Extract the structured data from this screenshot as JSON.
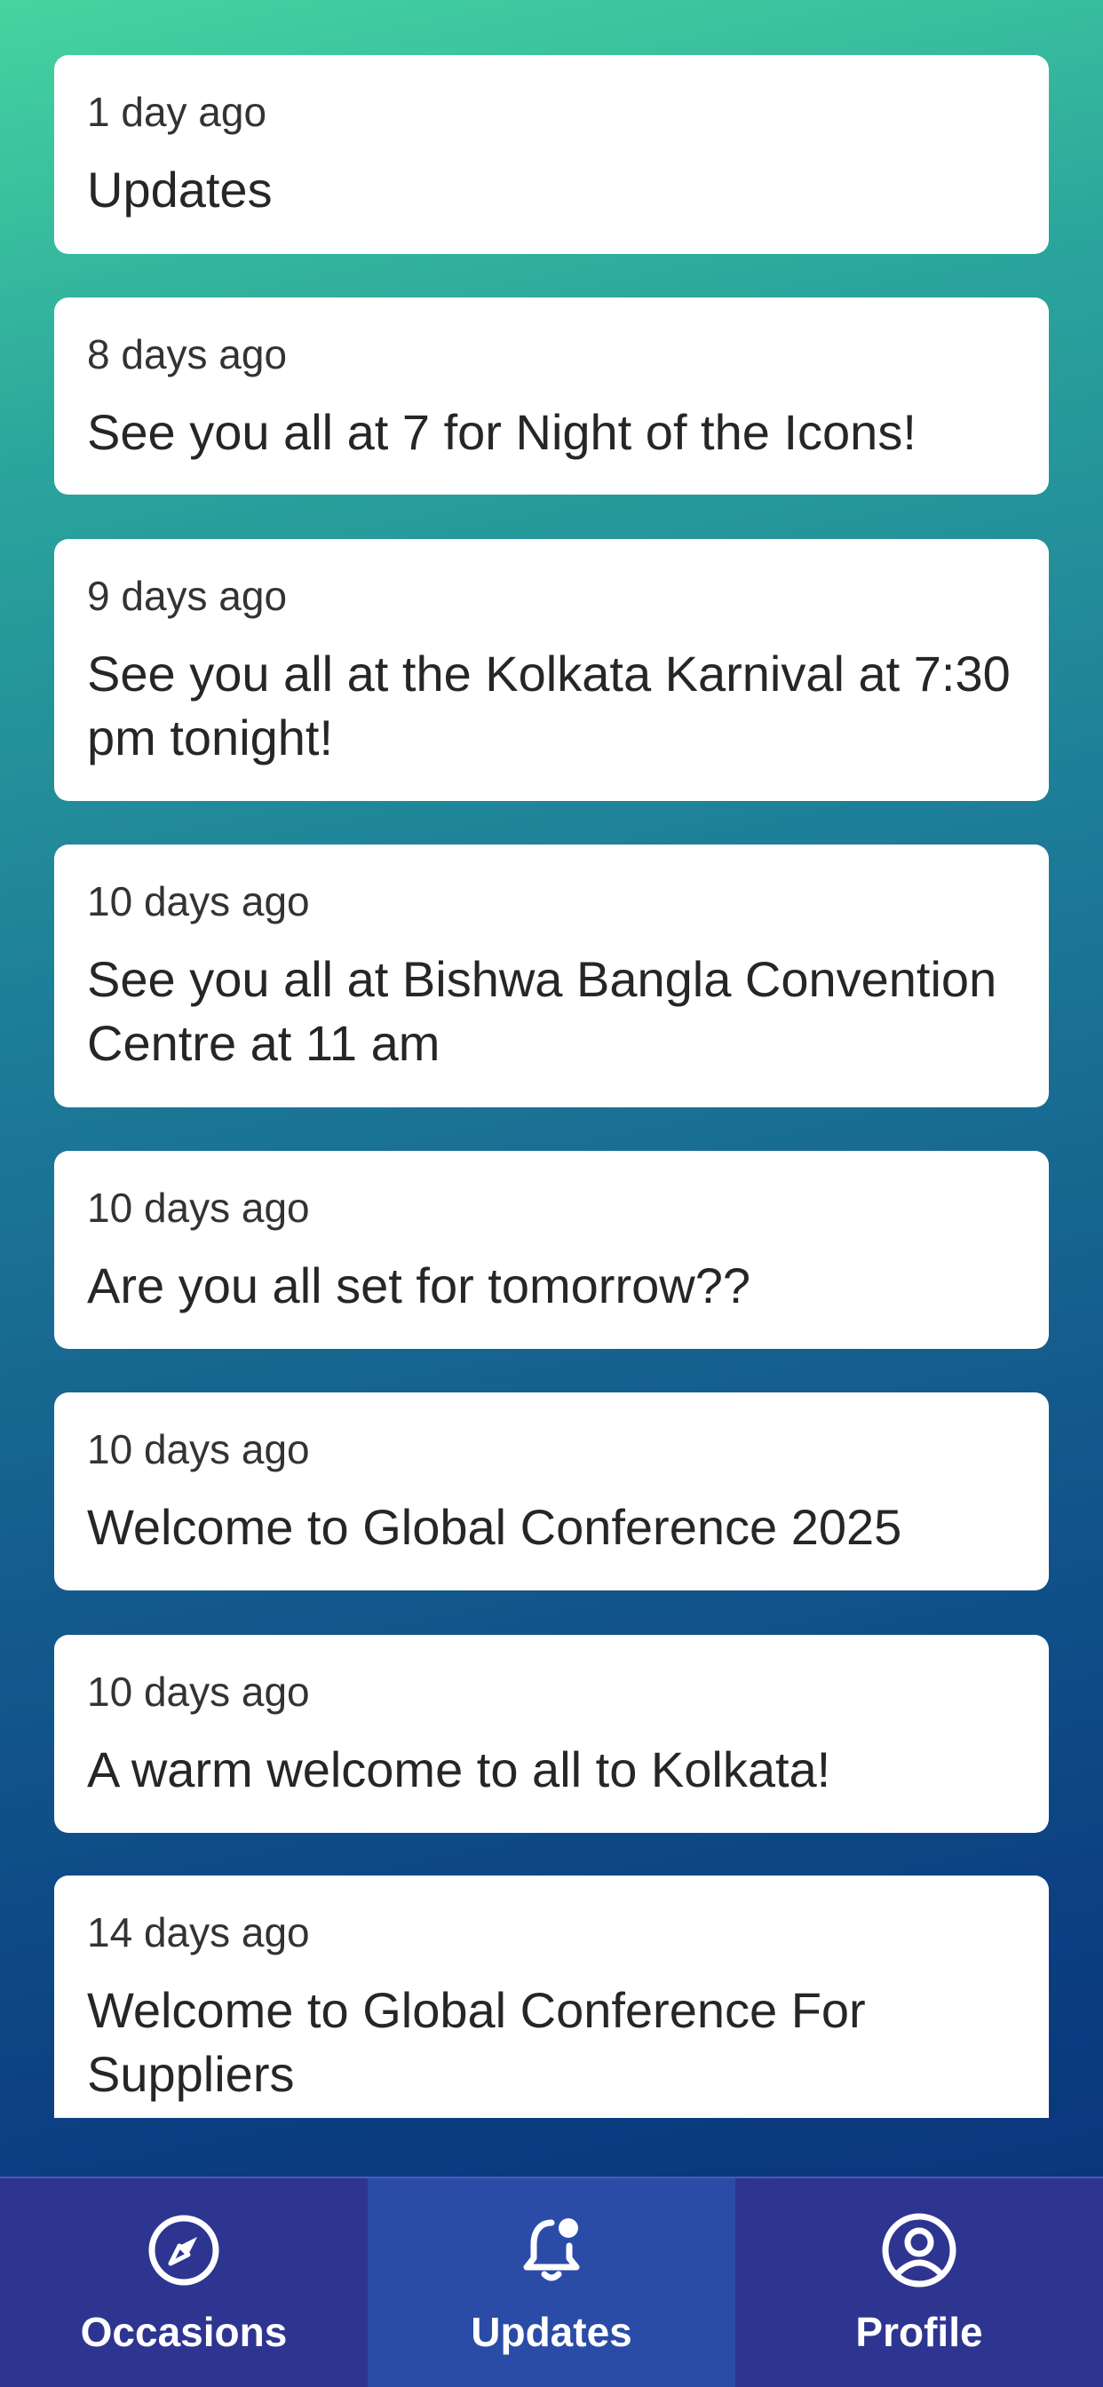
{
  "updates": [
    {
      "time": "1 day ago",
      "message": "Updates"
    },
    {
      "time": "8 days ago",
      "message": "See you all at 7 for Night of the Icons!"
    },
    {
      "time": "9 days ago",
      "message": "See you all at the Kolkata Karnival at 7:30 pm tonight!"
    },
    {
      "time": "10 days ago",
      "message": "See you all at Bishwa Bangla Convention Centre at 11 am"
    },
    {
      "time": "10 days ago",
      "message": "Are you all set for tomorrow??"
    },
    {
      "time": "10 days ago",
      "message": "Welcome to Global Conference 2025"
    },
    {
      "time": "10 days ago",
      "message": "A warm welcome to all to Kolkata!"
    },
    {
      "time": "14 days ago",
      "message": "Welcome to Global Conference For Suppliers"
    }
  ],
  "tabs": [
    {
      "label": "Occasions",
      "icon": "compass-icon"
    },
    {
      "label": "Updates",
      "icon": "bell-notification-icon",
      "active": true
    },
    {
      "label": "Profile",
      "icon": "user-circle-icon"
    }
  ],
  "colors": {
    "tabbar": "#2e3590",
    "tab_active": "#2a4ca6",
    "gradient_top": "#46d4a0",
    "gradient_bottom": "#0b2f78"
  }
}
